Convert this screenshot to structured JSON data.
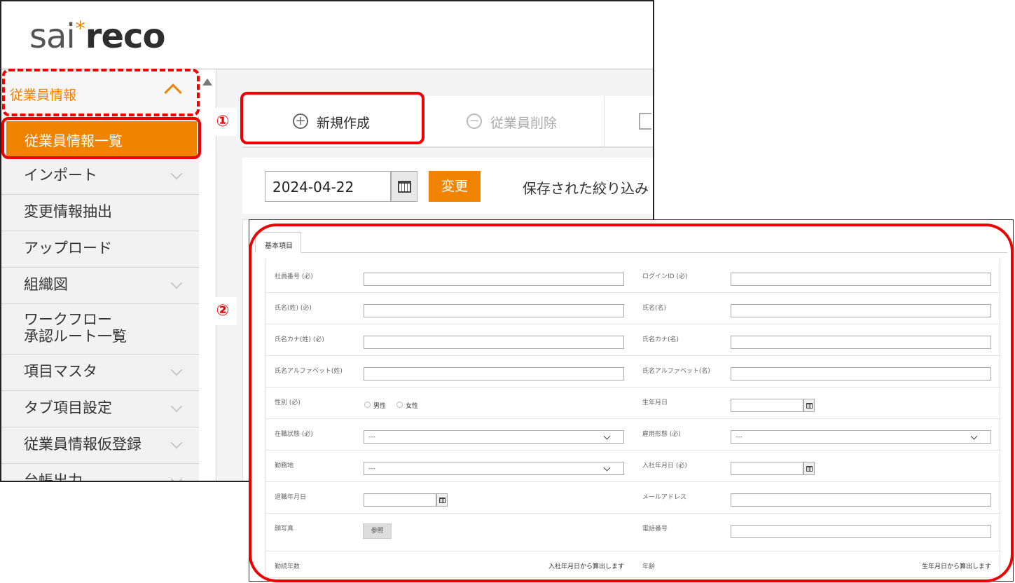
{
  "logo": {
    "part1": "sai",
    "star": "*",
    "part2": "reco"
  },
  "sidebar": {
    "section_label": "従業員情報",
    "active_item": "従業員情報一覧",
    "items": [
      {
        "label": "インポート"
      },
      {
        "label": "変更情報抽出"
      },
      {
        "label": "アップロード"
      },
      {
        "label": "組織図"
      },
      {
        "label_line1": "ワークフロー",
        "label_line2": "承認ルート一覧"
      },
      {
        "label": "項目マスタ"
      },
      {
        "label": "タブ項目設定"
      },
      {
        "label": "従業員情報仮登録"
      },
      {
        "label": "台帳出力"
      }
    ]
  },
  "toolbar": {
    "new_label": "新規作成",
    "delete_label": "従業員削除"
  },
  "datebar": {
    "date_value": "2024-04-22",
    "change_label": "変更",
    "filter_label": "保存された絞り込み"
  },
  "callouts": {
    "one": "①",
    "two": "②"
  },
  "form": {
    "tab_label": "基本項目",
    "fields": {
      "employee_no": "社員番号 (必)",
      "login_id": "ログインID (必)",
      "last_name": "氏名(姓) (必)",
      "first_name": "氏名(名)",
      "last_kana": "氏名カナ(姓) (必)",
      "first_kana": "氏名カナ(名)",
      "last_alpha": "氏名アルファベット(姓)",
      "first_alpha": "氏名アルファベット(名)",
      "gender": "性別 (必)",
      "gender_male": "男性",
      "gender_female": "女性",
      "birthdate": "生年月日",
      "employment_status": "在職状態 (必)",
      "employment_type": "雇用形態 (必)",
      "workplace": "勤務地",
      "hire_date": "入社年月日 (必)",
      "retire_date": "退職年月日",
      "email": "メールアドレス",
      "photo": "顔写真",
      "photo_button": "参照",
      "phone": "電話番号",
      "years_of_service": "勤続年数",
      "years_note": "入社年月日から算出します",
      "age": "年齢",
      "age_note": "生年月日から算出します"
    },
    "select_placeholder": "---"
  }
}
